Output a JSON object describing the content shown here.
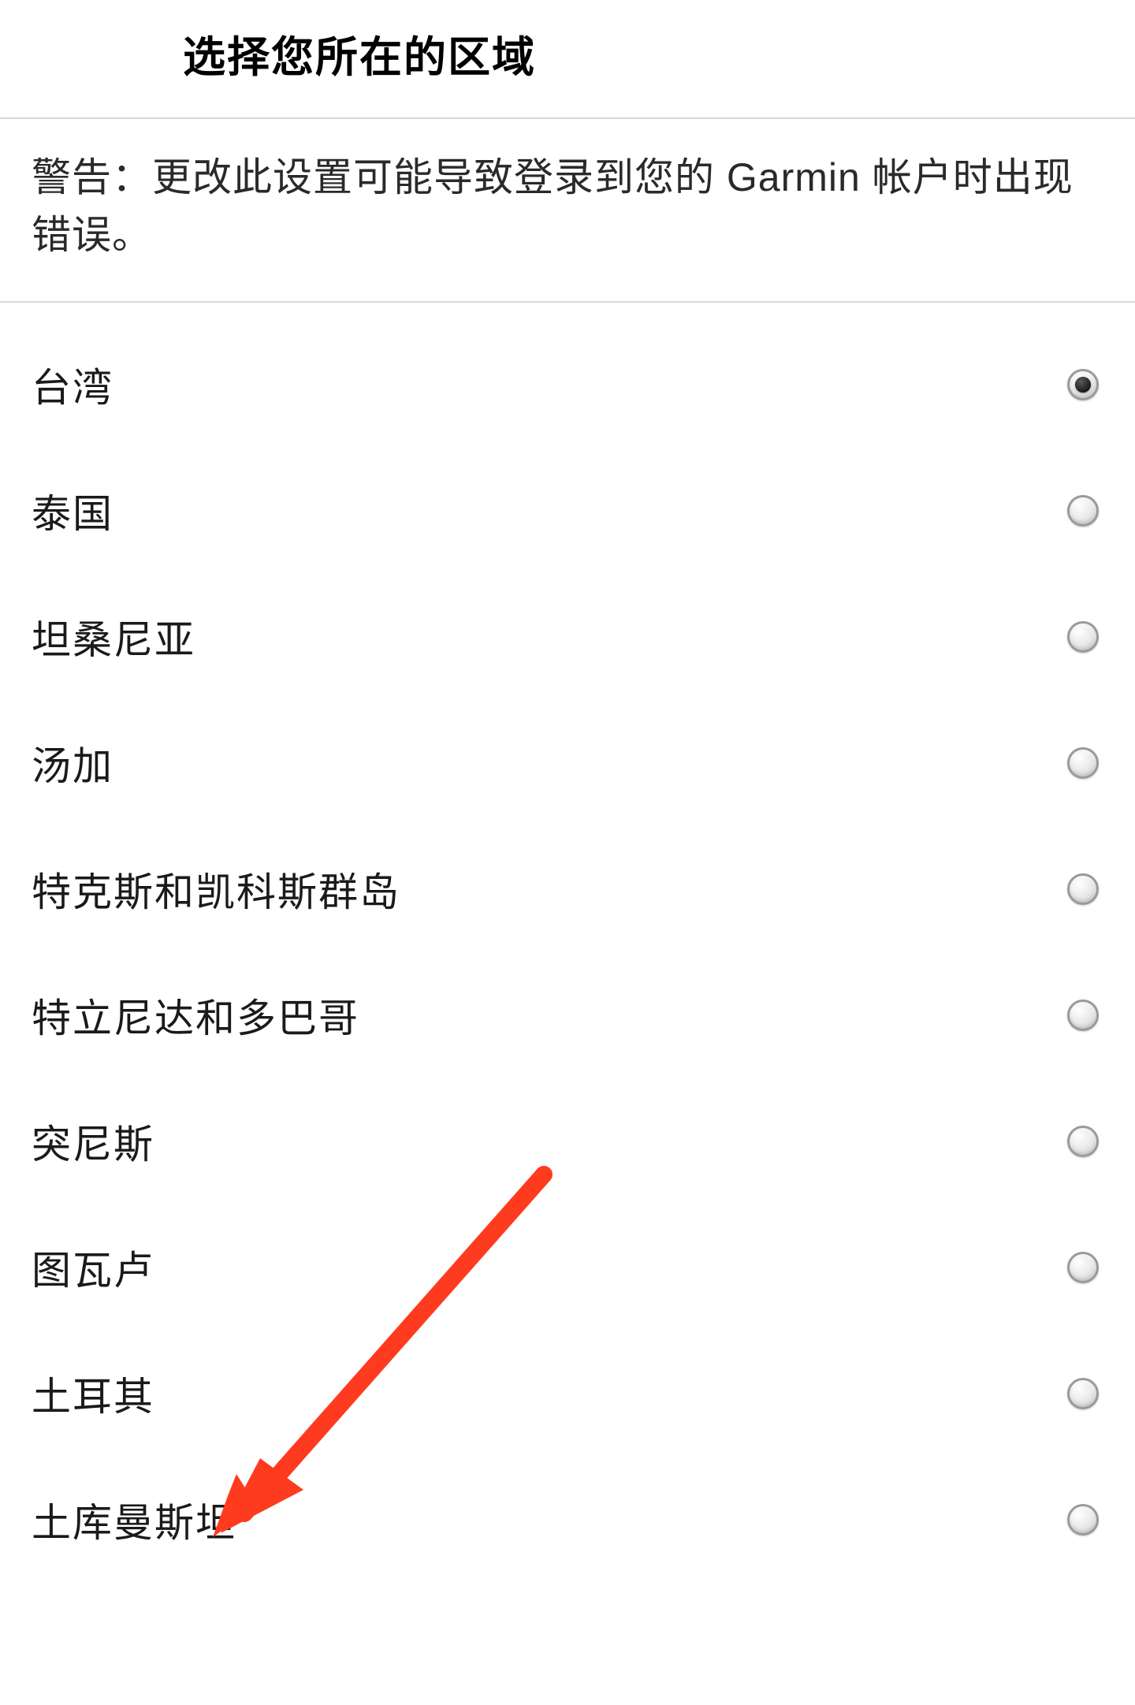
{
  "header": {
    "title": "选择您所在的区域"
  },
  "warning": {
    "text": "警告：更改此设置可能导致登录到您的 Garmin 帐户时出现错误。"
  },
  "regions": [
    {
      "label": "台湾",
      "selected": true
    },
    {
      "label": "泰国",
      "selected": false
    },
    {
      "label": "坦桑尼亚",
      "selected": false
    },
    {
      "label": "汤加",
      "selected": false
    },
    {
      "label": "特克斯和凯科斯群岛",
      "selected": false
    },
    {
      "label": "特立尼达和多巴哥",
      "selected": false
    },
    {
      "label": "突尼斯",
      "selected": false
    },
    {
      "label": "图瓦卢",
      "selected": false
    },
    {
      "label": "土耳其",
      "selected": false
    },
    {
      "label": "土库曼斯坦",
      "selected": false
    }
  ],
  "annotation": {
    "arrow_color": "#ff3b1f",
    "points_to": "土耳其"
  }
}
